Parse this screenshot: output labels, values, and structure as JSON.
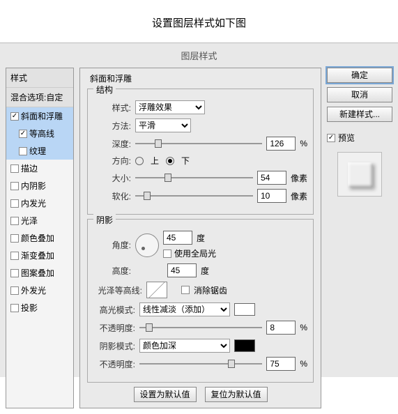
{
  "page_title": "设置图层样式如下图",
  "dialog_title": "图层样式",
  "sidebar": {
    "header1": "样式",
    "header2": "混合选项:自定",
    "items": [
      {
        "label": "斜面和浮雕",
        "checked": true,
        "sel": true,
        "indent": false
      },
      {
        "label": "等高线",
        "checked": true,
        "sel": true,
        "indent": true
      },
      {
        "label": "纹理",
        "checked": false,
        "sel": true,
        "indent": true
      },
      {
        "label": "描边",
        "checked": false,
        "sel": false,
        "indent": false
      },
      {
        "label": "内阴影",
        "checked": false,
        "sel": false,
        "indent": false
      },
      {
        "label": "内发光",
        "checked": false,
        "sel": false,
        "indent": false
      },
      {
        "label": "光泽",
        "checked": false,
        "sel": false,
        "indent": false
      },
      {
        "label": "颜色叠加",
        "checked": false,
        "sel": false,
        "indent": false
      },
      {
        "label": "渐变叠加",
        "checked": false,
        "sel": false,
        "indent": false
      },
      {
        "label": "图案叠加",
        "checked": false,
        "sel": false,
        "indent": false
      },
      {
        "label": "外发光",
        "checked": false,
        "sel": false,
        "indent": false
      },
      {
        "label": "投影",
        "checked": false,
        "sel": false,
        "indent": false
      }
    ]
  },
  "main_title": "斜面和浮雕",
  "structure": {
    "legend": "结构",
    "style_label": "样式:",
    "style_value": "浮雕效果",
    "method_label": "方法:",
    "method_value": "平滑",
    "depth_label": "深度:",
    "depth_value": "126",
    "depth_unit": "%",
    "direction_label": "方向:",
    "dir_up": "上",
    "dir_down": "下",
    "size_label": "大小:",
    "size_value": "54",
    "size_unit": "像素",
    "soften_label": "软化:",
    "soften_value": "10",
    "soften_unit": "像素"
  },
  "shadow": {
    "legend": "阴影",
    "angle_label": "角度:",
    "angle_value": "45",
    "angle_unit": "度",
    "global_label": "使用全局光",
    "alt_label": "高度:",
    "alt_value": "45",
    "alt_unit": "度",
    "gloss_label": "光泽等高线:",
    "antialias_label": "消除锯齿",
    "hilite_mode_label": "高光模式:",
    "hilite_mode_value": "线性减淡（添加）",
    "hilite_color": "#ffffff",
    "hilite_opacity_label": "不透明度:",
    "hilite_opacity_value": "8",
    "pct": "%",
    "shadow_mode_label": "阴影模式:",
    "shadow_mode_value": "颜色加深",
    "shadow_color": "#000000",
    "shadow_opacity_label": "不透明度:",
    "shadow_opacity_value": "75"
  },
  "bottom": {
    "make_default": "设置为默认值",
    "reset_default": "复位为默认值"
  },
  "right": {
    "ok": "确定",
    "cancel": "取消",
    "new_style": "新建样式...",
    "preview_label": "预览"
  }
}
